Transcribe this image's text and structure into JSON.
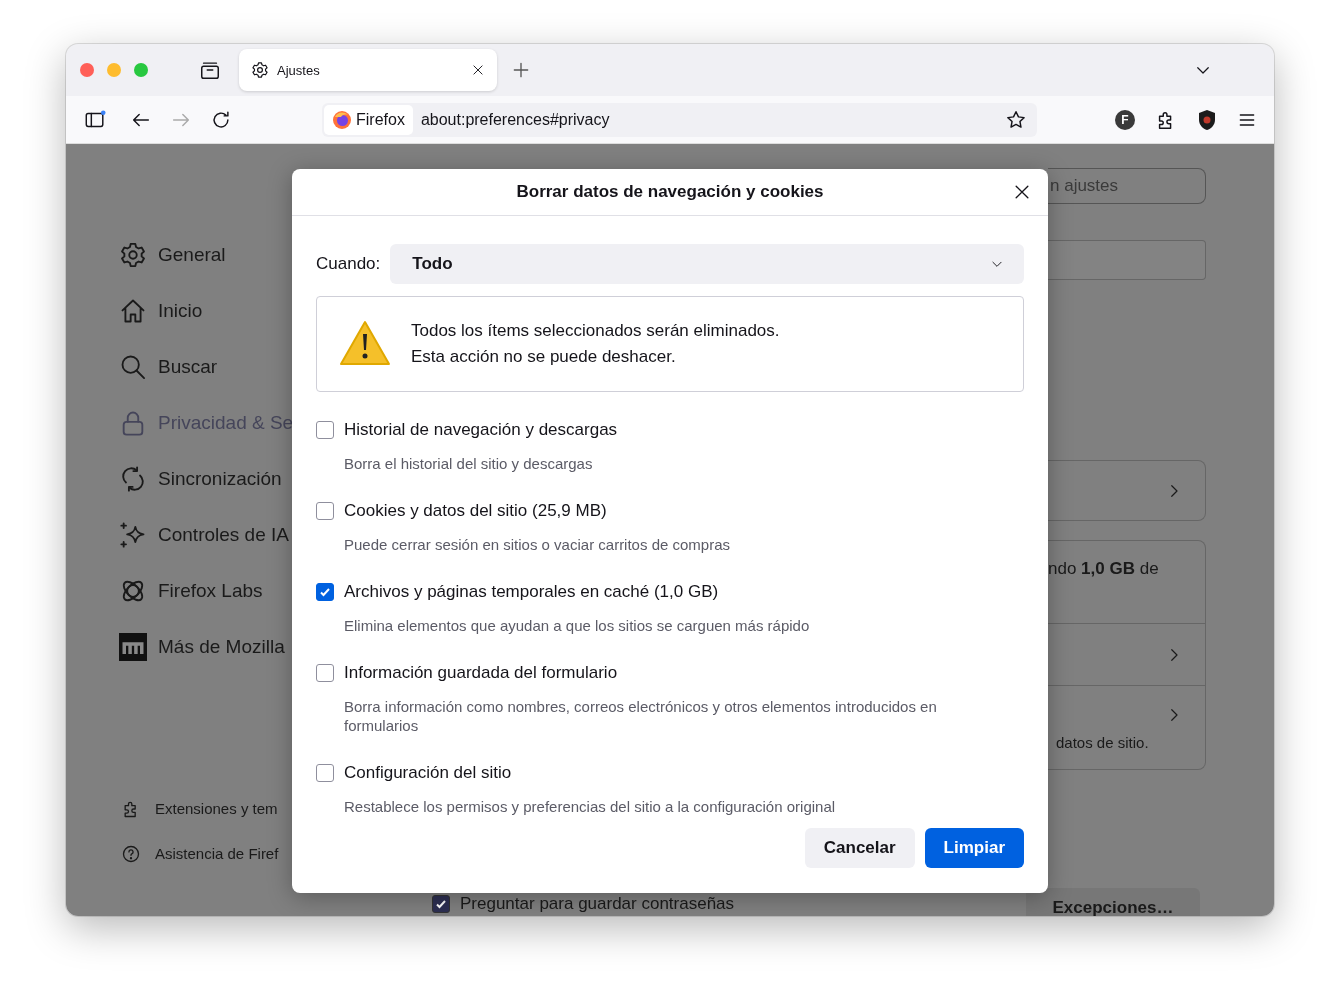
{
  "tabs": [
    {
      "label": "Ajustes",
      "selected": true
    }
  ],
  "toolbar": {
    "identity": "Firefox",
    "url": "about:preferences#privacy",
    "account_initial": "F"
  },
  "sidebar": {
    "items": [
      {
        "label": "General",
        "selected": false
      },
      {
        "label": "Inicio",
        "selected": false
      },
      {
        "label": "Buscar",
        "selected": false
      },
      {
        "label": "Privacidad & Se",
        "selected": true
      },
      {
        "label": "Sincronización",
        "selected": false
      },
      {
        "label": "Controles de IA",
        "selected": false
      },
      {
        "label": "Firefox Labs",
        "selected": false
      },
      {
        "label": "Más de Mozilla",
        "selected": false
      }
    ],
    "footer_links": [
      "Extensiones y tem",
      "Asistencia de Firef"
    ]
  },
  "background": {
    "search_placeholder": "n ajustes",
    "storage_text": "ndo **1,0 GB** de",
    "site_data_text": "datos de sitio.",
    "save_passwords": {
      "label": "Preguntar para guardar contraseñas",
      "checked": true
    },
    "exceptions_button": "Excepciones…"
  },
  "dialog": {
    "title": "Borrar datos de navegación y cookies",
    "when_label": "Cuando:",
    "when_value": "Todo",
    "warning": [
      "Todos los ítems seleccionados serán eliminados.",
      "Esta acción no se puede deshacer."
    ],
    "options": [
      {
        "label": "Historial de navegación y descargas",
        "description": "Borra el historial del sitio y descargas",
        "checked": false
      },
      {
        "label": "Cookies y datos del sitio (25,9 MB)",
        "description": "Puede cerrar sesión en sitios o vaciar carritos de compras",
        "checked": false
      },
      {
        "label": "Archivos y páginas temporales en caché (1,0 GB)",
        "description": "Elimina elementos que ayudan a que los sitios se carguen más rápido",
        "checked": true
      },
      {
        "label": "Información guardada del formulario",
        "description": "Borra información como nombres, correos electrónicos y otros elementos introducidos en formularios",
        "checked": false
      },
      {
        "label": "Configuración del sitio",
        "description": "Restablece los permisos y preferencias del sitio a la configuración original",
        "checked": false
      }
    ],
    "buttons": [
      {
        "label": "Cancelar",
        "kind": "secondary"
      },
      {
        "label": "Limpiar",
        "kind": "primary"
      }
    ]
  }
}
